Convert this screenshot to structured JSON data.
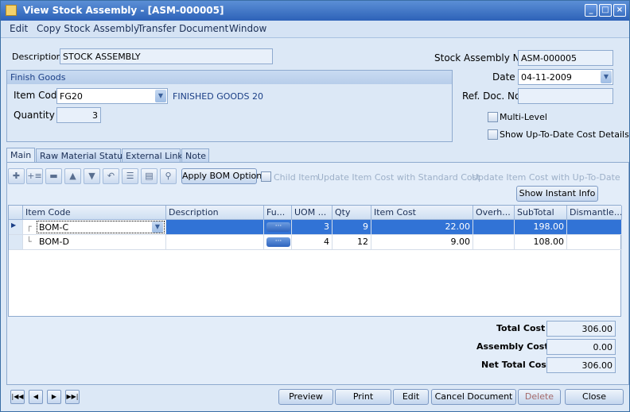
{
  "window": {
    "title": "View Stock Assembly  - [ASM-000005]"
  },
  "menu": [
    "Edit",
    "Copy Stock Assembly",
    "Transfer Document",
    "Window"
  ],
  "form": {
    "description_label": "Description",
    "description_value": "STOCK ASSEMBLY",
    "stock_no_label": "Stock Assembly No",
    "stock_no_value": "ASM-000005",
    "date_label": "Date",
    "date_value": "04-11-2009",
    "ref_label": "Ref. Doc. No",
    "ref_value": "",
    "multi_level": "Multi-Level",
    "show_cost": "Show Up-To-Date Cost Details"
  },
  "finish_goods": {
    "group_title": "Finish Goods",
    "item_code_label": "Item Code",
    "item_code_value": "FG20",
    "item_desc": "FINISHED GOODS 20",
    "quantity_label": "Quantity",
    "quantity_value": "3"
  },
  "tabs": [
    "Main",
    "Raw Material Status",
    "External Link",
    "Note"
  ],
  "toolbar": {
    "apply_bom": "Apply BOM Optional",
    "child_item": "Child Item",
    "update_std": "Update Item Cost with Standard Cost",
    "update_utd": "Update Item Cost with Up-To-Date Cos",
    "show_instant": "Show Instant Info"
  },
  "grid": {
    "columns": [
      "Item Code",
      "Description",
      "Fu...",
      "UOM ...",
      "Qty",
      "Item Cost",
      "Overh...",
      "SubTotal",
      "Dismantle..."
    ],
    "rows": [
      {
        "item_code": "BOM-C",
        "description": "",
        "uom": "3",
        "qty": "9",
        "item_cost": "22.00",
        "overhead": "",
        "subtotal": "198.00",
        "dismantle": ""
      },
      {
        "item_code": "BOM-D",
        "description": "",
        "uom": "4",
        "qty": "12",
        "item_cost": "9.00",
        "overhead": "",
        "subtotal": "108.00",
        "dismantle": ""
      }
    ]
  },
  "totals": {
    "total_label": "Total Cost",
    "total_value": "306.00",
    "assembly_label": "Assembly Cost",
    "assembly_value": "0.00",
    "net_label": "Net Total Cost",
    "net_value": "306.00"
  },
  "buttons": {
    "preview": "Preview",
    "print": "Print",
    "edit": "Edit",
    "cancel": "Cancel Document",
    "delete": "Delete",
    "close": "Close"
  },
  "colors": {
    "title_bar": "#2d62b8",
    "selected_row": "#3173d6",
    "background": "#dce8f6"
  }
}
